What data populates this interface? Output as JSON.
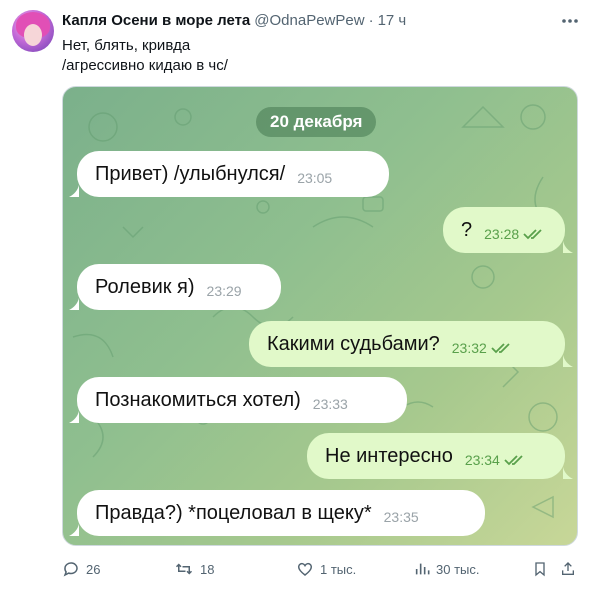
{
  "author": {
    "display_name": "Капля Осени в море лета",
    "handle": "@OdnaPewPew",
    "separator": "·",
    "time": "17 ч"
  },
  "tweet": {
    "line1": "Нет, блять, кривда",
    "line2": "/агрессивно кидаю в чс/"
  },
  "chat": {
    "date": "20 декабря",
    "messages": [
      {
        "direction": "in",
        "text": "Привет) /улыбнулся/",
        "time": "23:05"
      },
      {
        "direction": "out",
        "text": "?",
        "time": "23:28",
        "read": true
      },
      {
        "direction": "in",
        "text": "Ролевик я)",
        "time": "23:29"
      },
      {
        "direction": "out",
        "text": "Какими судьбами?",
        "time": "23:32",
        "read": true
      },
      {
        "direction": "in",
        "text": "Познакомиться хотел)",
        "time": "23:33"
      },
      {
        "direction": "out",
        "text": "Не интересно",
        "time": "23:34",
        "read": true
      },
      {
        "direction": "in",
        "text": "Правда?) *поцеловал в щеку*",
        "time": "23:35"
      }
    ],
    "colors": {
      "incoming": "#ffffff",
      "outgoing": "#e1f9c9",
      "read_check": "#59a04b",
      "background": "#8fbf8f"
    }
  },
  "actions": {
    "replies": "26",
    "retweets": "18",
    "likes": "1 тыс.",
    "views": "30 тыс."
  },
  "icons": [
    "more-icon",
    "reply-icon",
    "retweet-icon",
    "like-icon",
    "views-icon",
    "bookmark-icon",
    "share-icon",
    "double-check-icon"
  ]
}
